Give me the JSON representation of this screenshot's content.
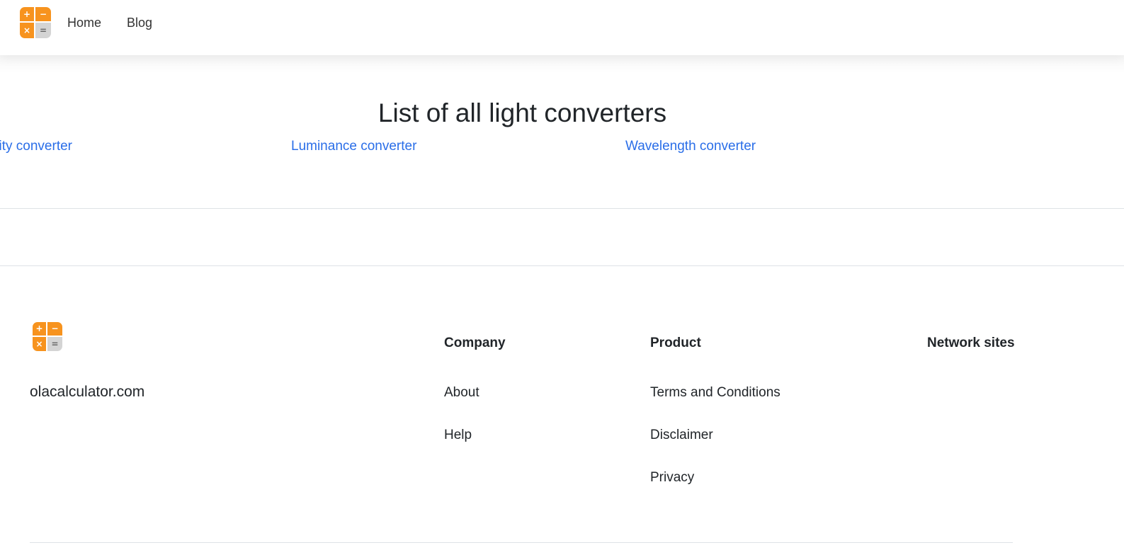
{
  "header": {
    "logo": {
      "symbols": [
        "+",
        "−",
        "×",
        "="
      ],
      "colors": {
        "primary": "#f7931e",
        "secondary": "#d4d4d4"
      }
    },
    "nav": [
      {
        "label": "Home"
      },
      {
        "label": "Blog"
      }
    ]
  },
  "main": {
    "title": "List of all light converters",
    "converters": [
      {
        "label": "ity converter"
      },
      {
        "label": "Luminance converter"
      },
      {
        "label": "Wavelength converter"
      }
    ],
    "link_color": "#2a6ee8"
  },
  "footer": {
    "site_name": "olacalculator.com",
    "columns": [
      {
        "heading": "Company",
        "links": [
          "About",
          "Help"
        ]
      },
      {
        "heading": "Product",
        "links": [
          "Terms and Conditions",
          "Disclaimer",
          "Privacy"
        ]
      },
      {
        "heading": "Network sites",
        "links": []
      }
    ]
  }
}
